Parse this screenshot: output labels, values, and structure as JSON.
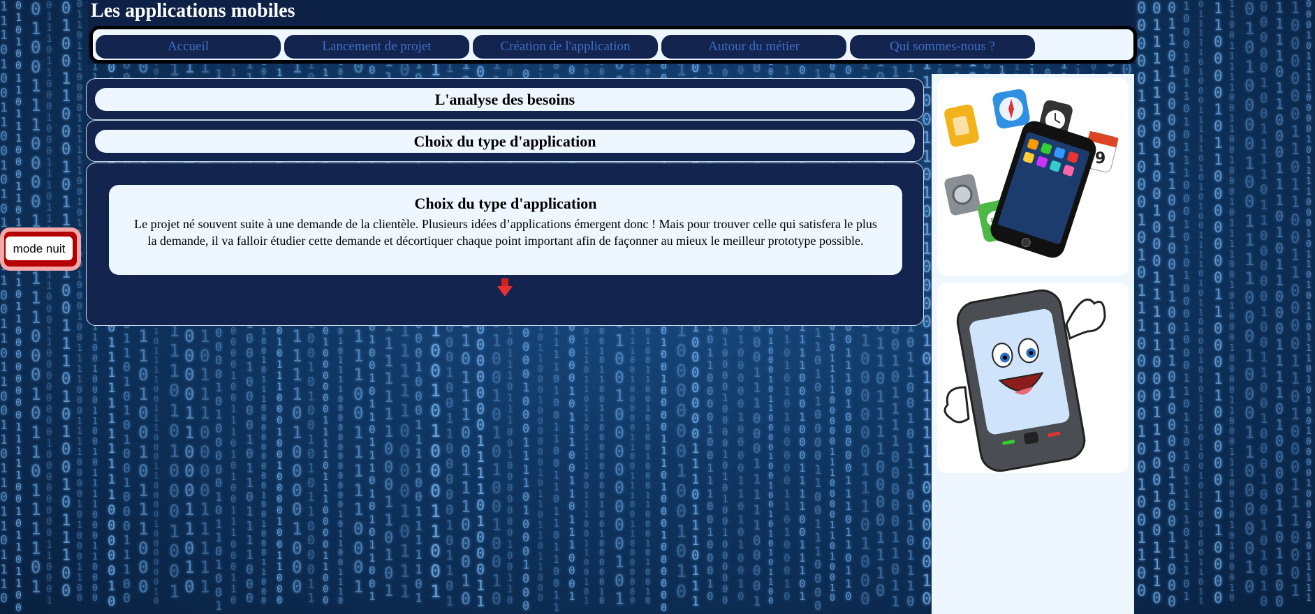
{
  "header": {
    "title": "Les applications mobiles"
  },
  "nav": {
    "items": [
      {
        "label": "Accueil"
      },
      {
        "label": "Lancement de projet"
      },
      {
        "label": "Création de l'application"
      },
      {
        "label": "Autour du métier"
      },
      {
        "label": "Qui sommes-nous ?"
      }
    ]
  },
  "mode_toggle": {
    "label": "mode nuit"
  },
  "sections": [
    {
      "title": "L'analyse des besoins"
    },
    {
      "title": "Choix du type d'application"
    }
  ],
  "content": {
    "title": "Choix du type d'application",
    "text": "Le projet né souvent suite à une demande de la clientèle. Plusieurs idées d’applications émergent donc ! Mais pour trouver celle qui satisfera le plus la demande, il va falloir étudier cette demande et décortiquer chaque point important afin de façonner au mieux le meilleur prototype possible.",
    "arrow_icon": "down-arrow-icon"
  },
  "sidebar": {
    "images": [
      {
        "icon": "smartphone-app-icons-illustration"
      },
      {
        "icon": "cartoon-smartphone-thumbs-up-illustration"
      }
    ]
  },
  "colors": {
    "nav_bg": "#eef6ff",
    "nav_item_bg": "#13244e",
    "nav_item_text": "#3f6fc7",
    "section_bg": "#13244e",
    "mode_nuit_border": "#b40000"
  }
}
